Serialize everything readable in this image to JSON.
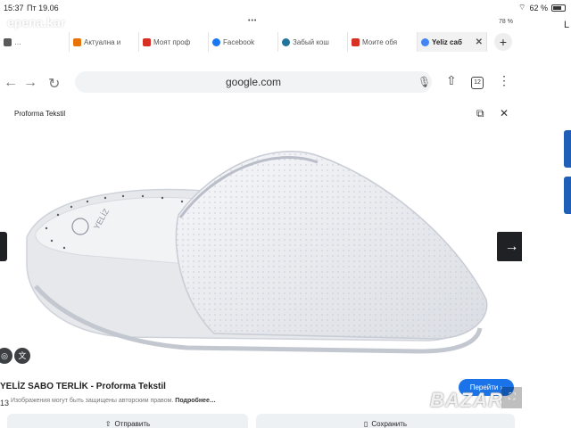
{
  "device_status": {
    "time": "15:37",
    "date": "Пт 19.06",
    "battery": "62 %"
  },
  "inner_status": {
    "dots": "•••",
    "battery": "78 %"
  },
  "browser": {
    "tabs": [
      {
        "label": "…",
        "favicon_color": "#5a5a5a"
      },
      {
        "label": "Актуална и",
        "favicon_color": "#e8710a"
      },
      {
        "label": "Моят проф",
        "favicon_color": "#d93025"
      },
      {
        "label": "Facebook",
        "favicon_color": "#1877f2"
      },
      {
        "label": "Забый кош",
        "favicon_color": "#21759b"
      },
      {
        "label": "Моите обя",
        "favicon_color": "#d93025"
      },
      {
        "label": "Yeliz саб",
        "favicon_color": "#4285f4",
        "active": true
      }
    ],
    "new_tab": "+",
    "url": "google.com",
    "tab_count": "12"
  },
  "viewer": {
    "source": "Proforma Tekstil",
    "result_title": "YELİZ SABO TERLİK - Proforma Tekstil",
    "note_prefix": "Изображения могут быть защищены авторским правом.",
    "note_link": "Подробнее…",
    "page_index": "13",
    "visit_button": "Перейти",
    "share_button": "Отправить",
    "save_button": "Сохранить",
    "insole_brand": "YELİZ"
  },
  "watermarks": {
    "top": "ерепа.kar",
    "bottom": "BAZAR"
  },
  "colors": {
    "accent": "#1a73e8",
    "dark": "#202124",
    "strip": "#1f5fb8"
  }
}
